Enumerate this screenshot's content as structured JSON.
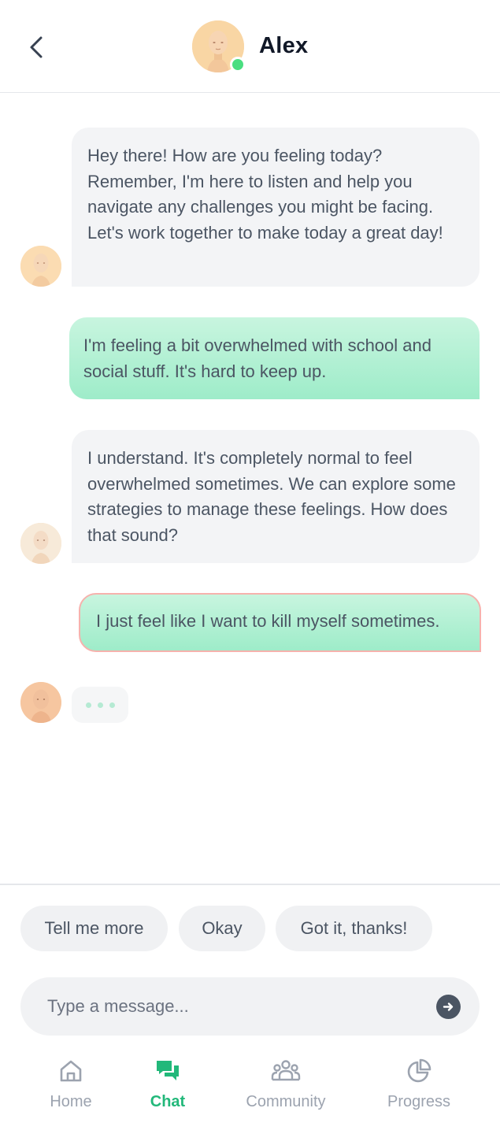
{
  "header": {
    "contact_name": "Alex",
    "status": "online",
    "back_icon": "chevron-left-icon"
  },
  "messages": [
    {
      "sender": "bot",
      "text": "Hey there! How are you feeling today? Remember, I'm here to listen and help you navigate any challenges you might be facing. Let's work together to make today a great day!"
    },
    {
      "sender": "user",
      "text": "I'm feeling a bit overwhelmed with school and social stuff. It's hard to keep up."
    },
    {
      "sender": "bot",
      "text": "I understand. It's completely normal to feel overwhelmed sometimes. We can explore some strategies to manage these feelings. How does that sound?"
    },
    {
      "sender": "user",
      "text": "I just feel like I want to kill myself sometimes.",
      "flagged": true
    }
  ],
  "typing_indicator": true,
  "quick_replies": [
    "Tell me more",
    "Okay",
    "Got it, thanks!"
  ],
  "composer": {
    "placeholder": "Type a message...",
    "send_icon": "arrow-right-circle-icon"
  },
  "nav": {
    "items": [
      {
        "label": "Home",
        "icon": "home-icon"
      },
      {
        "label": "Chat",
        "icon": "chat-bubbles-icon",
        "active": true
      },
      {
        "label": "Community",
        "icon": "community-icon"
      },
      {
        "label": "Progress",
        "icon": "pie-chart-icon"
      }
    ]
  },
  "colors": {
    "accent": "#22b87a",
    "user_bubble": "#b3f0d4",
    "bot_bubble": "#f3f4f6",
    "online": "#4ade80",
    "flag_border": "#f6b2ad"
  }
}
